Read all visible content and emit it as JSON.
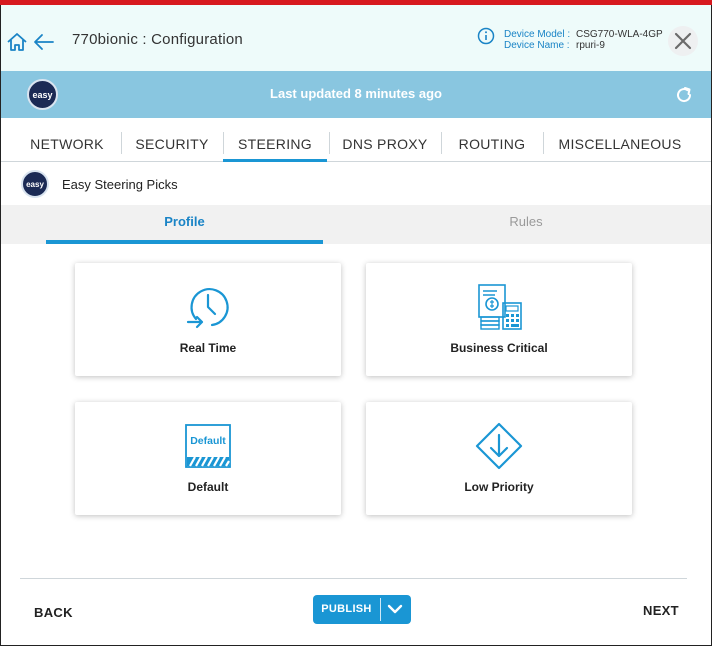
{
  "header": {
    "title": "770bionic : Configuration",
    "device_model_label": "Device Model :",
    "device_model_value": "CSG770-WLA-4GP",
    "device_name_label": "Device Name :",
    "device_name_value": "rpuri-9",
    "icons": [
      "home-icon",
      "back-arrow-icon",
      "info-icon",
      "close-icon"
    ]
  },
  "status": {
    "logo_text": "easy",
    "text": "Last updated 8 minutes ago",
    "icon": "refresh-icon"
  },
  "tabs": [
    {
      "label": "NETWORK",
      "active": false
    },
    {
      "label": "SECURITY",
      "active": false
    },
    {
      "label": "STEERING",
      "active": true
    },
    {
      "label": "DNS PROXY",
      "active": false
    },
    {
      "label": "ROUTING",
      "active": false
    },
    {
      "label": "MISCELLANEOUS",
      "active": false
    }
  ],
  "subheader": {
    "logo_text": "easy",
    "title": "Easy Steering Picks"
  },
  "subtabs": [
    {
      "label": "Profile",
      "active": true
    },
    {
      "label": "Rules",
      "active": false
    }
  ],
  "cards": [
    {
      "label": "Real Time",
      "icon": "clock-arrow-icon"
    },
    {
      "label": "Business Critical",
      "icon": "documents-calculator-icon"
    },
    {
      "label": "Default",
      "icon": "default-badge-icon",
      "badge_text": "Default"
    },
    {
      "label": "Low Priority",
      "icon": "diamond-down-arrow-icon"
    }
  ],
  "footer": {
    "back_label": "BACK",
    "publish_label": "PUBLISH",
    "next_label": "NEXT"
  },
  "colors": {
    "accent": "#1a96d4",
    "top_bar": "#d7191f",
    "status_bar": "#89c6e0",
    "header_bg": "#eefbfa"
  }
}
